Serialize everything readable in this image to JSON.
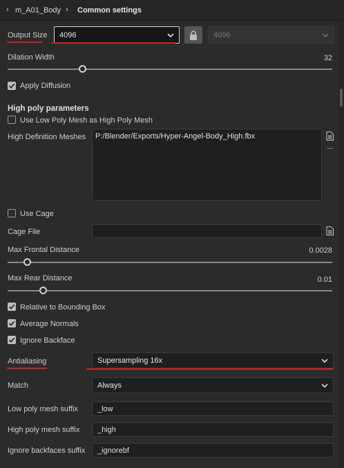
{
  "breadcrumb": {
    "item1": "m_A01_Body",
    "item2": "Common settings"
  },
  "output_size": {
    "label": "Output Size",
    "value": "4096",
    "locked_value": "4096"
  },
  "dilation": {
    "label": "Dilation Width",
    "value": "32",
    "fraction": 0.23
  },
  "apply_diffusion": {
    "label": "Apply Diffusion",
    "checked": true
  },
  "high_poly": {
    "heading": "High poly parameters",
    "use_low_poly": {
      "label": "Use Low Poly Mesh as High Poly Mesh",
      "checked": false
    },
    "meshes_label": "High Definition Meshes",
    "meshes_value": "P:/Blender/Exports/Hyper-Angel-Body_High.fbx"
  },
  "use_cage": {
    "label": "Use Cage",
    "checked": false
  },
  "cage_file": {
    "label": "Cage File",
    "value": ""
  },
  "max_frontal": {
    "label": "Max Frontal Distance",
    "value": "0.0028",
    "fraction": 0.06
  },
  "max_rear": {
    "label": "Max Rear Distance",
    "value": "0.01",
    "fraction": 0.11
  },
  "relative_bbox": {
    "label": "Relative to Bounding Box",
    "checked": true
  },
  "average_normals": {
    "label": "Average Normals",
    "checked": true
  },
  "ignore_backface": {
    "label": "Ignore Backface",
    "checked": true
  },
  "antialiasing": {
    "label": "Antialiasing",
    "value": "Supersampling 16x"
  },
  "match": {
    "label": "Match",
    "value": "Always"
  },
  "low_suffix": {
    "label": "Low poly mesh suffix",
    "value": "_low"
  },
  "high_suffix": {
    "label": "High poly mesh suffix",
    "value": "_high"
  },
  "ignore_suffix": {
    "label": "Ignore backfaces suffix",
    "value": "_ignorebf"
  },
  "colors": {
    "annotation": "#d52020",
    "background": "#2b2b2b",
    "field": "#1f1f1f"
  }
}
